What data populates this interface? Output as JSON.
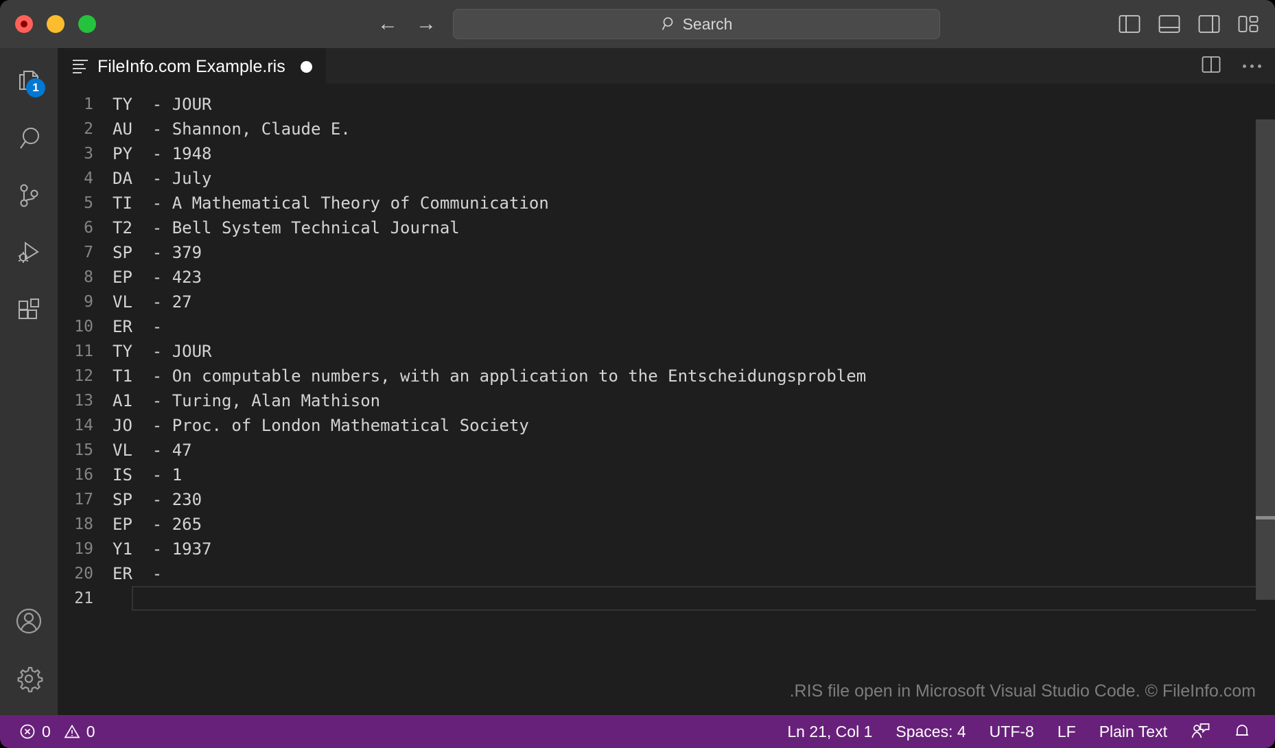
{
  "titlebar": {
    "traffic": {
      "close": "close-window",
      "minimize": "minimize-window",
      "maximize": "maximize-window"
    },
    "back_label": "←",
    "forward_label": "→",
    "search": {
      "placeholder": "Search",
      "value": "",
      "label": "Search"
    },
    "layout_buttons": [
      {
        "name": "toggle-primary-sidebar",
        "label": "Toggle Primary Side Bar"
      },
      {
        "name": "toggle-panel",
        "label": "Toggle Panel"
      },
      {
        "name": "toggle-secondary-sidebar",
        "label": "Toggle Secondary Side Bar"
      },
      {
        "name": "customize-layout",
        "label": "Customize Layout"
      }
    ]
  },
  "activitybar": {
    "top": [
      {
        "name": "explorer",
        "label": "Explorer",
        "badge": "1"
      },
      {
        "name": "search",
        "label": "Search",
        "badge": ""
      },
      {
        "name": "source-control",
        "label": "Source Control",
        "badge": ""
      },
      {
        "name": "run-and-debug",
        "label": "Run and Debug",
        "badge": ""
      },
      {
        "name": "extensions",
        "label": "Extensions",
        "badge": ""
      }
    ],
    "bottom": [
      {
        "name": "accounts",
        "label": "Accounts"
      },
      {
        "name": "settings",
        "label": "Manage"
      }
    ]
  },
  "editor": {
    "tab": {
      "title": "FileInfo.com Example.ris",
      "dirty": true
    },
    "actions": [
      {
        "name": "split-editor",
        "label": "Split Editor Right"
      },
      {
        "name": "more-actions",
        "label": "More Actions..."
      }
    ],
    "watermark": ".RIS file open in Microsoft Visual Studio Code. © FileInfo.com",
    "active_line": 21,
    "lines": [
      {
        "n": "1",
        "text": "TY  - JOUR"
      },
      {
        "n": "2",
        "text": "AU  - Shannon, Claude E."
      },
      {
        "n": "3",
        "text": "PY  - 1948"
      },
      {
        "n": "4",
        "text": "DA  - July"
      },
      {
        "n": "5",
        "text": "TI  - A Mathematical Theory of Communication"
      },
      {
        "n": "6",
        "text": "T2  - Bell System Technical Journal"
      },
      {
        "n": "7",
        "text": "SP  - 379"
      },
      {
        "n": "8",
        "text": "EP  - 423"
      },
      {
        "n": "9",
        "text": "VL  - 27"
      },
      {
        "n": "10",
        "text": "ER  -"
      },
      {
        "n": "11",
        "text": "TY  - JOUR"
      },
      {
        "n": "12",
        "text": "T1  - On computable numbers, with an application to the Entscheidungsproblem"
      },
      {
        "n": "13",
        "text": "A1  - Turing, Alan Mathison"
      },
      {
        "n": "14",
        "text": "JO  - Proc. of London Mathematical Society"
      },
      {
        "n": "15",
        "text": "VL  - 47"
      },
      {
        "n": "16",
        "text": "IS  - 1"
      },
      {
        "n": "17",
        "text": "SP  - 230"
      },
      {
        "n": "18",
        "text": "EP  - 265"
      },
      {
        "n": "19",
        "text": "Y1  - 1937"
      },
      {
        "n": "20",
        "text": "ER  -"
      },
      {
        "n": "21",
        "text": ""
      }
    ]
  },
  "statusbar": {
    "errors": "0",
    "warnings": "0",
    "cursor": "Ln 21, Col 1",
    "indentation": "Spaces: 4",
    "encoding": "UTF-8",
    "eol": "LF",
    "language": "Plain Text",
    "feedback_label": "Tweet Feedback",
    "notifications_label": "No Notifications",
    "bg_color": "#68217a"
  }
}
